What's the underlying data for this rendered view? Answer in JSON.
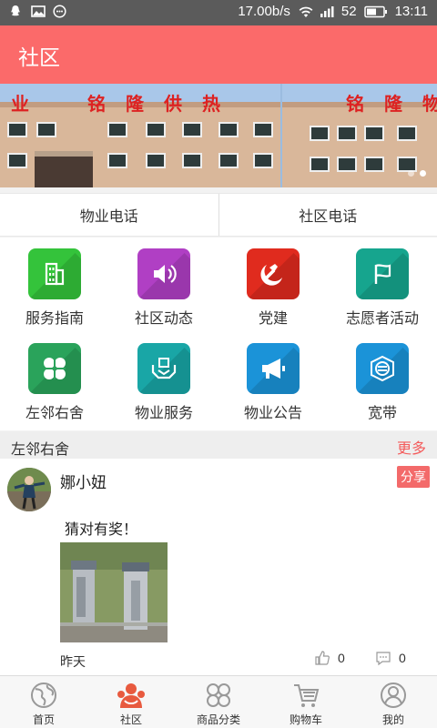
{
  "status_bar": {
    "speed": "17.00b/s",
    "battery": "52",
    "time": "13:11"
  },
  "header": {
    "title": "社区"
  },
  "banner": {
    "signs": [
      "业　铭隆供热",
      "铭隆物"
    ],
    "slide_count": 2,
    "active_slide": 2
  },
  "phones": {
    "property": "物业电话",
    "community": "社区电话"
  },
  "grid": [
    {
      "label": "服务指南",
      "icon": "building-icon",
      "color": "#34c33b"
    },
    {
      "label": "社区动态",
      "icon": "speaker-icon",
      "color": "#b03fc4"
    },
    {
      "label": "党建",
      "icon": "hammer-sickle-icon",
      "color": "#e02b1e"
    },
    {
      "label": "志愿者活动",
      "icon": "flag-icon",
      "color": "#16a58e"
    },
    {
      "label": "左邻右舍",
      "icon": "clover-icon",
      "color": "#2aa35b"
    },
    {
      "label": "物业服务",
      "icon": "hands-box-icon",
      "color": "#19a6a6"
    },
    {
      "label": "物业公告",
      "icon": "megaphone-icon",
      "color": "#1b93d8"
    },
    {
      "label": "宽带",
      "icon": "broadband-icon",
      "color": "#1b93d8"
    }
  ],
  "section": {
    "title": "左邻右舍",
    "more": "更多"
  },
  "post": {
    "username": "娜小妞",
    "share": "分享",
    "content": "猜对有奖！",
    "time": "昨天",
    "likes": "0",
    "comments": "0"
  },
  "nav": [
    {
      "label": "首页",
      "icon": "globe-icon",
      "active": false
    },
    {
      "label": "社区",
      "icon": "community-people-icon",
      "active": true
    },
    {
      "label": "商品分类",
      "icon": "clover-outline-icon",
      "active": false
    },
    {
      "label": "购物车",
      "icon": "cart-icon",
      "active": false
    },
    {
      "label": "我的",
      "icon": "user-icon",
      "active": false
    }
  ],
  "colors": {
    "accent": "#fb6a6a",
    "status_bar": "#5b5b5b"
  }
}
